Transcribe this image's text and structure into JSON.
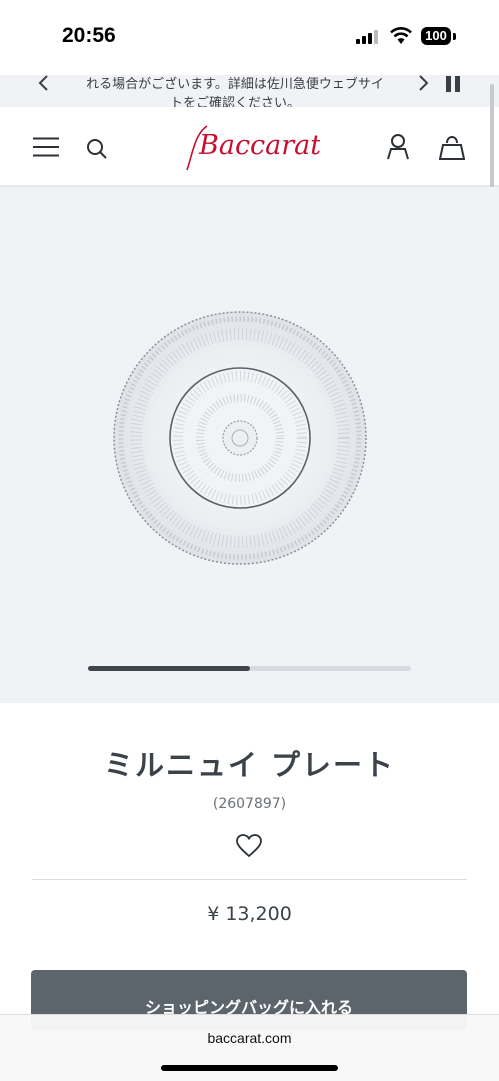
{
  "status_bar": {
    "time": "20:56",
    "battery": "100"
  },
  "announcement": {
    "line1": "れる場合がございます。詳細は佐川急便ウェブサイ",
    "line2": "トをご確認ください。"
  },
  "header": {
    "logo_text": "Baccarat",
    "brand_color": "#c8102e"
  },
  "gallery": {
    "progress_fraction": 0.5
  },
  "product": {
    "title": "ミルニュイ プレート",
    "code": "(2607897)",
    "price": "¥ 13,200",
    "add_to_bag_label": "ショッピングバッグに入れる"
  },
  "browser": {
    "url": "baccarat.com"
  },
  "icons": {
    "menu": "hamburger-menu-icon",
    "search": "search-icon",
    "account": "account-icon",
    "bag": "shopping-bag-icon",
    "wishlist": "heart-icon",
    "prev": "chevron-left-icon",
    "next": "chevron-right-icon",
    "pause": "pause-icon"
  }
}
